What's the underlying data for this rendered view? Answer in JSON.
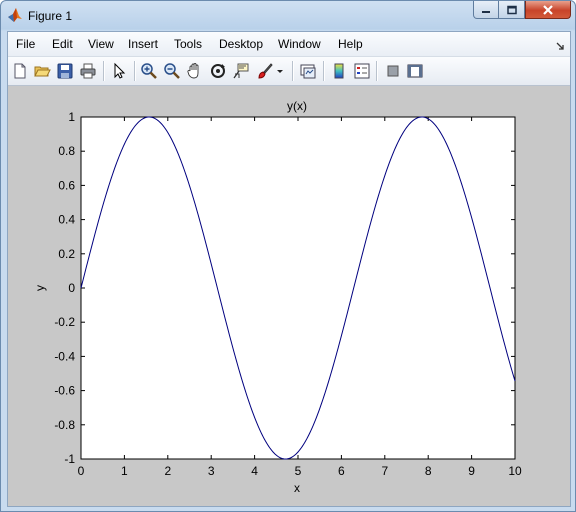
{
  "window": {
    "title": "Figure 1",
    "minimize_icon": "minimize-icon",
    "maximize_icon": "maximize-icon",
    "close_icon": "close-icon"
  },
  "menu": {
    "items": [
      "File",
      "Edit",
      "View",
      "Insert",
      "Tools",
      "Desktop",
      "Window",
      "Help"
    ],
    "dock_icon": "dock-arrow-icon"
  },
  "toolbar": {
    "icons": [
      "new-figure-icon",
      "open-file-icon",
      "save-icon",
      "print-icon",
      "edit-plot-arrow-icon",
      "zoom-in-icon",
      "zoom-out-icon",
      "pan-hand-icon",
      "rotate-3d-icon",
      "data-cursor-icon",
      "brush-icon",
      "brush-dropdown-icon",
      "link-plot-icon",
      "colorbar-icon",
      "legend-icon",
      "hide-plot-tools-icon",
      "show-plot-tools-icon"
    ]
  },
  "colors": {
    "line": "#00007f",
    "figure_background": "#c8c8c8",
    "axes_background": "#ffffff"
  },
  "chart_data": {
    "type": "line",
    "title": "y(x)",
    "xlabel": "x",
    "ylabel": "y",
    "xlim": [
      0,
      10
    ],
    "ylim": [
      -1,
      1
    ],
    "xticks": [
      "0",
      "1",
      "2",
      "3",
      "4",
      "5",
      "6",
      "7",
      "8",
      "9",
      "10"
    ],
    "yticks": [
      "1",
      "0.8",
      "0.6",
      "0.4",
      "0.2",
      "0",
      "-0.2",
      "-0.4",
      "-0.6",
      "-0.8",
      "-1"
    ],
    "grid": false,
    "series": [
      {
        "function": "sin(x)",
        "x": [
          0,
          0.5,
          1,
          1.5,
          2,
          2.5,
          3,
          3.5,
          4,
          4.5,
          5,
          5.5,
          6,
          6.5,
          7,
          7.5,
          8,
          8.5,
          9,
          9.5,
          10
        ],
        "y": [
          0,
          0.479,
          0.841,
          0.997,
          0.909,
          0.598,
          0.141,
          -0.351,
          -0.757,
          -0.978,
          -0.959,
          -0.706,
          -0.279,
          0.215,
          0.657,
          0.938,
          0.989,
          0.798,
          0.412,
          -0.075,
          -0.544
        ]
      }
    ]
  }
}
